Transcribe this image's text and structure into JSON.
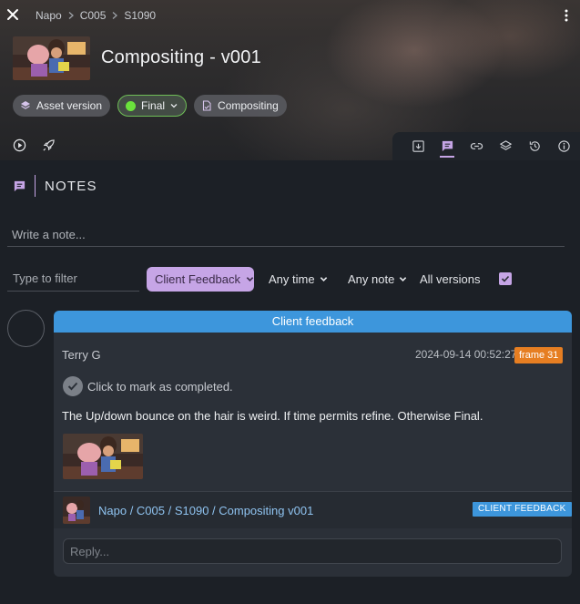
{
  "header": {
    "breadcrumb": [
      "Napo",
      "C005",
      "S1090"
    ],
    "title": "Compositing - v001",
    "chips": {
      "asset_version": "Asset version",
      "status": "Final",
      "task": "Compositing"
    }
  },
  "notes": {
    "section_title": "NOTES",
    "write_placeholder": "Write a note...",
    "filter_placeholder": "Type to filter",
    "filter_category": "Client Feedback",
    "time_filter": "Any time",
    "note_filter": "Any note",
    "versions_filter": "All versions",
    "items": [
      {
        "category": "Client feedback",
        "author": "Terry G",
        "timestamp": "2024-09-14 00:52:27",
        "frame": "frame 31",
        "complete_label": "Click to mark as completed.",
        "text": "The Up/down bounce on the hair is weird. If time permits refine. Otherwise Final.",
        "link_path": "Napo / C005 / S1090 / Compositing v001",
        "link_badge": "CLIENT FEEDBACK",
        "reply_placeholder": "Reply..."
      }
    ]
  },
  "colors": {
    "accent": "#c6a5e6",
    "banner": "#3d96dc",
    "status_green": "#6be23c",
    "frame_orange": "#e67e22"
  }
}
